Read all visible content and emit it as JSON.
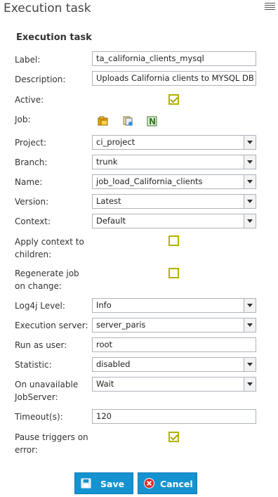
{
  "header": {
    "title": "Execution task",
    "menu_icon": "hamburger-menu-icon"
  },
  "section_title": "Execution task",
  "form": {
    "label": {
      "label": "Label:",
      "value": "ta_california_clients_mysql"
    },
    "description": {
      "label": "Description:",
      "value": "Uploads California clients to MYSQL DB"
    },
    "active": {
      "label": "Active:",
      "checked": true
    },
    "job": {
      "label": "Job:",
      "icons": [
        "folder-icon",
        "branch-icon",
        "nexus-icon"
      ]
    },
    "project": {
      "label": "Project:",
      "value": "ci_project"
    },
    "branch": {
      "label": "Branch:",
      "value": "trunk"
    },
    "name": {
      "label": "Name:",
      "value": "job_load_California_clients"
    },
    "version": {
      "label": "Version:",
      "value": "Latest"
    },
    "context": {
      "label": "Context:",
      "value": "Default"
    },
    "apply_context": {
      "label_line1": "Apply context to",
      "label_line2": "children:",
      "checked": false
    },
    "regenerate": {
      "label_line1": "Regenerate job",
      "label_line2": "on change:",
      "checked": false
    },
    "log4j": {
      "label": "Log4j Level:",
      "value": "Info"
    },
    "execution_server": {
      "label": "Execution server:",
      "value": "server_paris"
    },
    "run_as": {
      "label": "Run as user:",
      "value": "root"
    },
    "statistic": {
      "label": "Statistic:",
      "value": "disabled"
    },
    "unavailable": {
      "label_line1": "On unavailable",
      "label_line2": "JobServer:",
      "value": "Wait"
    },
    "timeout": {
      "label": "Timeout(s):",
      "value": "120"
    },
    "pause_triggers": {
      "label_line1": "Pause triggers on",
      "label_line2": "error:",
      "checked": true
    }
  },
  "buttons": {
    "save_label": "Save",
    "cancel_label": "Cancel"
  },
  "colors": {
    "accent": "#1592d0",
    "checkbox": "#b2b200"
  }
}
